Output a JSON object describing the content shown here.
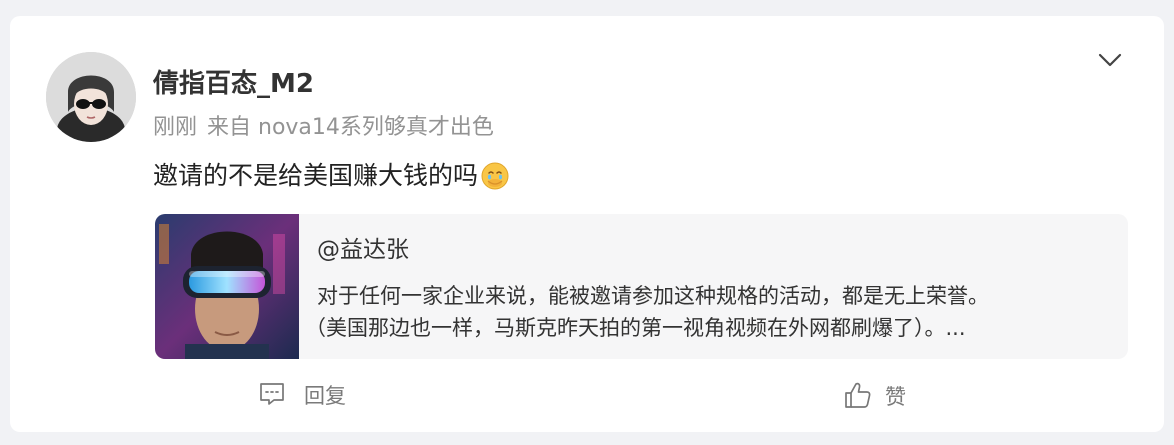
{
  "post": {
    "username": "倩指百态_M2",
    "time": "刚刚",
    "source": "来自 nova14系列够真才出色",
    "content": "邀请的不是给美国赚大钱的吗",
    "content_emoji": "face-holding-back-tears-emoji"
  },
  "repost": {
    "author": "@益达张",
    "line1": "对于任何一家企业来说，能被邀请参加这种规格的活动，都是无上荣誉。",
    "line2": "（美国那边也一样，马斯克昨天拍的第一视角视频在外网都刷爆了）。..."
  },
  "actions": {
    "reply_label": "回复",
    "like_label": "赞"
  },
  "icons": [
    "chevron-down-icon",
    "comment-icon",
    "thumbs-up-icon"
  ],
  "colors": {
    "background": "#f1f2f5",
    "card": "#ffffff",
    "repost_bg": "#f6f6f7",
    "meta_text": "#939393",
    "action_text": "#7a7a7a"
  }
}
